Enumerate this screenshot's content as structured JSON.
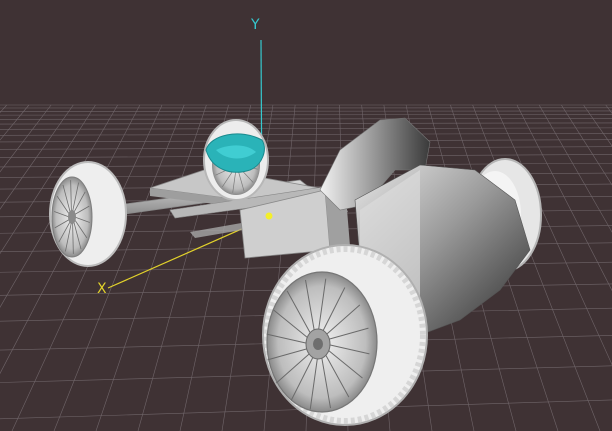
{
  "viewport": {
    "background": "#3f3234",
    "grid_color": "#8a8186",
    "axes": {
      "y": {
        "label": "Y",
        "color": "#35c9cf"
      },
      "x": {
        "label": "X",
        "color": "#e2d22b"
      }
    },
    "model": {
      "body_color": "#6e6e6e",
      "tire_color": "#ececec",
      "steering_wheel_color": "#2ab3b8",
      "pivot_marker_color": "#f4ef2a"
    }
  }
}
